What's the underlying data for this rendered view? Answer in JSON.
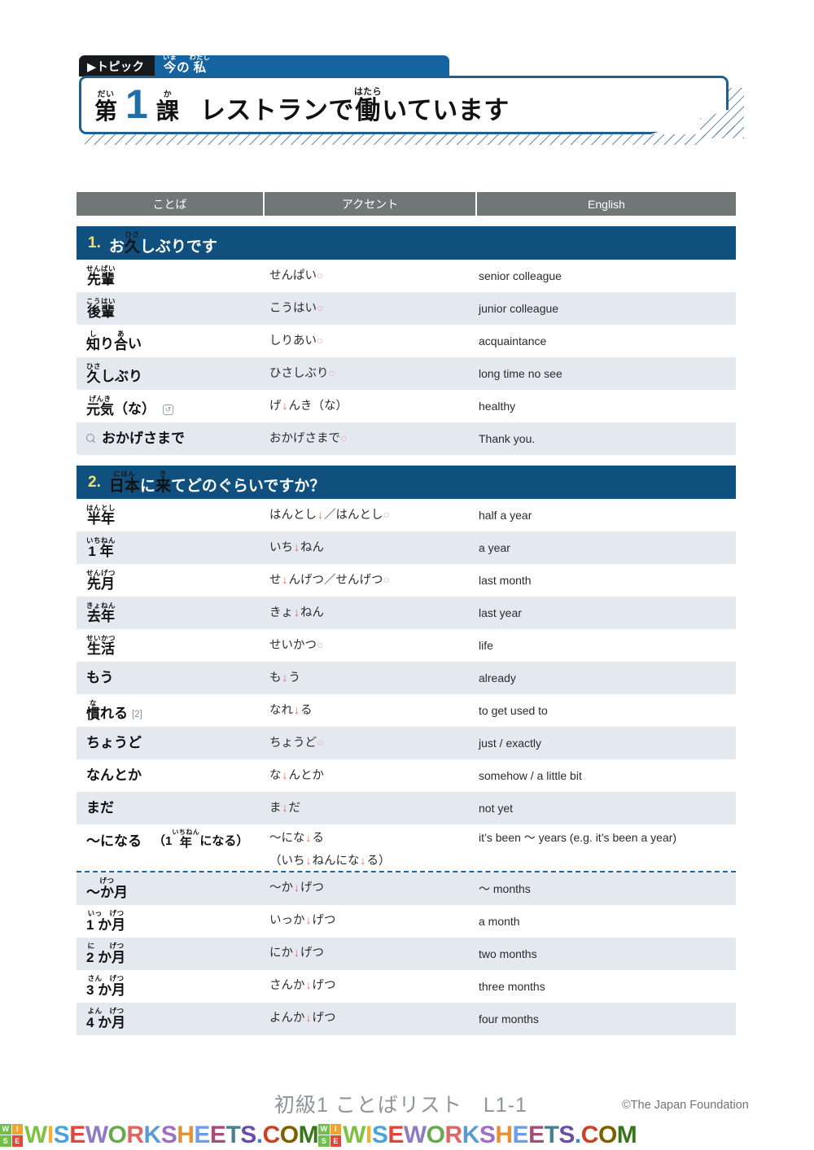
{
  "topic": {
    "tab_label": "▶トピック",
    "title_ruby_1": "いま",
    "title_base_1": "今",
    "title_plain_1": "の",
    "title_ruby_2": "わたし",
    "title_base_2": "私"
  },
  "lesson": {
    "dai_ruby": "だい",
    "dai_base": "第",
    "number": "1",
    "ka_ruby": "か",
    "ka_base": "課",
    "title_plain_1": "レストランで",
    "title_ruby": "はたら",
    "title_base": "働",
    "title_plain_2": "いています"
  },
  "table": {
    "headers": [
      "ことば",
      "アクセント",
      "English"
    ]
  },
  "sections": [
    {
      "number": "1.",
      "title_plain_1": "お",
      "title_ruby": "ひさ",
      "title_base": "久",
      "title_plain_2": "しぶりです",
      "rows": [
        {
          "ruby": "せんぱい",
          "base": "先輩",
          "tail": "",
          "accent_parts": [
            {
              "t": "せんぱい",
              "k": "p"
            },
            {
              "t": "○",
              "k": "flat"
            }
          ],
          "english": "senior colleague"
        },
        {
          "ruby": "こうはい",
          "base": "後輩",
          "tail": "",
          "accent_parts": [
            {
              "t": "こうはい",
              "k": "p"
            },
            {
              "t": "○",
              "k": "flat"
            }
          ],
          "english": "junior colleague"
        },
        {
          "ruby": "し",
          "base": "知",
          "tail": "り",
          "ruby2": "あ",
          "base2": "合",
          "tail2": "い",
          "accent_parts": [
            {
              "t": "しりあい",
              "k": "p"
            },
            {
              "t": "○",
              "k": "flat"
            }
          ],
          "english": "acquaintance"
        },
        {
          "ruby": "ひさ",
          "base": "久",
          "tail": "しぶり",
          "accent_parts": [
            {
              "t": "ひさしぶり",
              "k": "p"
            },
            {
              "t": "○",
              "k": "flat"
            }
          ],
          "english": "long time no see"
        },
        {
          "ruby": "げんき",
          "base": "元気",
          "tail": "（な）",
          "icon": "repeat-icon",
          "accent_parts": [
            {
              "t": "げ",
              "k": "p"
            },
            {
              "t": "↓",
              "k": "drop"
            },
            {
              "t": "んき（な）",
              "k": "p"
            }
          ],
          "english": "healthy"
        },
        {
          "ruby": "",
          "base": "",
          "tail": "おかげさまで",
          "icon_prefix": "search-icon",
          "accent_parts": [
            {
              "t": "おかげさまで",
              "k": "p"
            },
            {
              "t": "○",
              "k": "flat"
            }
          ],
          "english": "Thank you."
        }
      ]
    },
    {
      "number": "2.",
      "title_ruby_1": "にほん",
      "title_base_1": "日本",
      "title_plain_1": "に",
      "title_ruby_2": "き",
      "title_base_2": "来",
      "title_plain_2": "てどのぐらいですか？",
      "rows": [
        {
          "ruby": "はんとし",
          "base": "半年",
          "tail": "",
          "accent_parts": [
            {
              "t": "はんとし",
              "k": "p"
            },
            {
              "t": "↓",
              "k": "drop"
            },
            {
              "t": "／はんとし",
              "k": "p"
            },
            {
              "t": "○",
              "k": "flat"
            }
          ],
          "english": "half a year"
        },
        {
          "ruby": "いちねん",
          "base": "1 年",
          "tail": "",
          "accent_parts": [
            {
              "t": "いち",
              "k": "p"
            },
            {
              "t": "↓",
              "k": "drop"
            },
            {
              "t": "ねん",
              "k": "p"
            }
          ],
          "english": "a year"
        },
        {
          "ruby": "せんげつ",
          "base": "先月",
          "tail": "",
          "accent_parts": [
            {
              "t": "せ",
              "k": "p"
            },
            {
              "t": "↓",
              "k": "drop"
            },
            {
              "t": "んげつ／せんげつ",
              "k": "p"
            },
            {
              "t": "○",
              "k": "flat"
            }
          ],
          "english": "last month"
        },
        {
          "ruby": "きょねん",
          "base": "去年",
          "tail": "",
          "accent_parts": [
            {
              "t": "きょ",
              "k": "p"
            },
            {
              "t": "↓",
              "k": "drop"
            },
            {
              "t": "ねん",
              "k": "p"
            }
          ],
          "english": "last year"
        },
        {
          "ruby": "せいかつ",
          "base": "生活",
          "tail": "",
          "accent_parts": [
            {
              "t": "せいかつ",
              "k": "p"
            },
            {
              "t": "○",
              "k": "flat"
            }
          ],
          "english": "life"
        },
        {
          "ruby": "",
          "base": "",
          "tail": "もう",
          "accent_parts": [
            {
              "t": "も",
              "k": "p"
            },
            {
              "t": "↓",
              "k": "drop"
            },
            {
              "t": "う",
              "k": "p"
            }
          ],
          "english": "already"
        },
        {
          "ruby": "な",
          "base": "慣",
          "tail": "れる",
          "verb_mark": "[2]",
          "accent_parts": [
            {
              "t": "なれ",
              "k": "p"
            },
            {
              "t": "↓",
              "k": "drop"
            },
            {
              "t": "る",
              "k": "p"
            }
          ],
          "english": "to get used to"
        },
        {
          "ruby": "",
          "base": "",
          "tail": "ちょうど",
          "accent_parts": [
            {
              "t": "ちょうど",
              "k": "p"
            },
            {
              "t": "○",
              "k": "flat"
            }
          ],
          "english": "just / exactly"
        },
        {
          "ruby": "",
          "base": "",
          "tail": "なんとか",
          "accent_parts": [
            {
              "t": "な",
              "k": "p"
            },
            {
              "t": "↓",
              "k": "drop"
            },
            {
              "t": "んとか",
              "k": "p"
            }
          ],
          "english": "somehow / a little bit"
        },
        {
          "ruby": "",
          "base": "",
          "tail": "まだ",
          "accent_parts": [
            {
              "t": "ま",
              "k": "p"
            },
            {
              "t": "↓",
              "k": "drop"
            },
            {
              "t": "だ",
              "k": "p"
            }
          ],
          "english": "not yet"
        },
        {
          "ruby": "",
          "base": "",
          "tail": "〜になる",
          "example_plain_1": "（1 ",
          "example_ruby": "いちねん",
          "example_base": "年",
          "example_plain_2": "になる）",
          "example_full": "（1 年になる）",
          "accent_parts": [
            {
              "t": "〜にな",
              "k": "p"
            },
            {
              "t": "↓",
              "k": "drop"
            },
            {
              "t": "る",
              "k": "p"
            }
          ],
          "accent_line2": [
            {
              "t": "（いち",
              "k": "p"
            },
            {
              "t": "↓",
              "k": "drop"
            },
            {
              "t": "ねんにな",
              "k": "p"
            },
            {
              "t": "↓",
              "k": "drop"
            },
            {
              "t": "る）",
              "k": "p"
            }
          ],
          "english": "it’s been 〜 years (e.g. it’s been a year)",
          "tall": true
        },
        {
          "separator_before": true,
          "ruby": "げつ",
          "base": "〜か月",
          "tail": "",
          "ruby_offset": true,
          "accent_parts": [
            {
              "t": "〜か",
              "k": "p"
            },
            {
              "t": "↓",
              "k": "drop"
            },
            {
              "t": "げつ",
              "k": "p"
            }
          ],
          "english": "〜 months"
        },
        {
          "ruby": "いっ　げつ",
          "base": "1 か月",
          "tail": "",
          "accent_parts": [
            {
              "t": "いっか",
              "k": "p"
            },
            {
              "t": "↓",
              "k": "drop"
            },
            {
              "t": "げつ",
              "k": "p"
            }
          ],
          "english": "a month"
        },
        {
          "ruby": "に　　げつ",
          "base": "2 か月",
          "tail": "",
          "accent_parts": [
            {
              "t": "にか",
              "k": "p"
            },
            {
              "t": "↓",
              "k": "drop"
            },
            {
              "t": "げつ",
              "k": "p"
            }
          ],
          "english": "two months"
        },
        {
          "ruby": "さん　げつ",
          "base": "3 か月",
          "tail": "",
          "accent_parts": [
            {
              "t": "さんか",
              "k": "p"
            },
            {
              "t": "↓",
              "k": "drop"
            },
            {
              "t": "げつ",
              "k": "p"
            }
          ],
          "english": "three months"
        },
        {
          "ruby": "よん　げつ",
          "base": "4 か月",
          "tail": "",
          "accent_parts": [
            {
              "t": "よんか",
              "k": "p"
            },
            {
              "t": "↓",
              "k": "drop"
            },
            {
              "t": "げつ",
              "k": "p"
            }
          ],
          "english": "four months"
        }
      ]
    }
  ],
  "footer": {
    "center": "初級1 ことばリスト　L1-1",
    "copyright": "©The Japan Foundation"
  },
  "watermark": {
    "logo_letters": [
      "W",
      "I",
      "S",
      "E"
    ],
    "logo_colors": [
      "#6fbf4a",
      "#f0a52a",
      "#6fbf4a",
      "#e2453c"
    ],
    "text": "WISEWORKSHEETS.COM",
    "letter_colors": [
      "#7dc242",
      "#f2b134",
      "#4aa3df",
      "#e2453c",
      "#8e7cc3",
      "#6aa84f",
      "#e06666",
      "#5b9bd5",
      "#9b6fc4",
      "#e69138",
      "#6d9eeb",
      "#a64d79",
      "#45818e",
      "#674ea7",
      "#3d85c6",
      "#cc4125",
      "#7f6000",
      "#38761d"
    ]
  },
  "colors": {
    "navy": "#10507e",
    "banner_blue": "#1f5f91",
    "tab_blue": "#15639f",
    "header_gray": "#717677",
    "row_alt": "#e4e9f0",
    "accent_drop": "#e06a4e",
    "accent_flat": "#eda89a",
    "section_num": "#f2e06a"
  }
}
